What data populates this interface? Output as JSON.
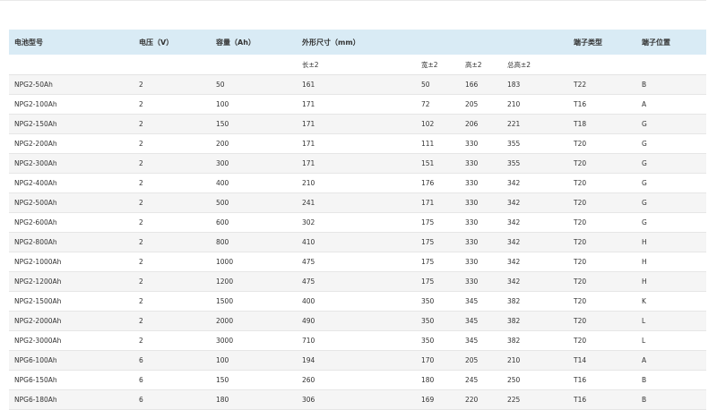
{
  "headers": {
    "model": "电池型号",
    "voltage": "电压（V）",
    "capacity": "容量（Ah）",
    "dimensions": "外形尺寸（mm）",
    "terminal_type": "端子类型",
    "terminal_position": "端子位置"
  },
  "subheaders": {
    "length": "长±2",
    "width": "宽±2",
    "height": "高±2",
    "total_height": "总高±2"
  },
  "rows": [
    [
      "NPG2-50Ah",
      "2",
      "50",
      "161",
      "50",
      "166",
      "183",
      "T22",
      "B"
    ],
    [
      "NPG2-100Ah",
      "2",
      "100",
      "171",
      "72",
      "205",
      "210",
      "T16",
      "A"
    ],
    [
      "NPG2-150Ah",
      "2",
      "150",
      "171",
      "102",
      "206",
      "221",
      "T18",
      "G"
    ],
    [
      "NPG2-200Ah",
      "2",
      "200",
      "171",
      "111",
      "330",
      "355",
      "T20",
      "G"
    ],
    [
      "NPG2-300Ah",
      "2",
      "300",
      "171",
      "151",
      "330",
      "355",
      "T20",
      "G"
    ],
    [
      "NPG2-400Ah",
      "2",
      "400",
      "210",
      "176",
      "330",
      "342",
      "T20",
      "G"
    ],
    [
      "NPG2-500Ah",
      "2",
      "500",
      "241",
      "171",
      "330",
      "342",
      "T20",
      "G"
    ],
    [
      "NPG2-600Ah",
      "2",
      "600",
      "302",
      "175",
      "330",
      "342",
      "T20",
      "G"
    ],
    [
      "NPG2-800Ah",
      "2",
      "800",
      "410",
      "175",
      "330",
      "342",
      "T20",
      "H"
    ],
    [
      "NPG2-1000Ah",
      "2",
      "1000",
      "475",
      "175",
      "330",
      "342",
      "T20",
      "H"
    ],
    [
      "NPG2-1200Ah",
      "2",
      "1200",
      "475",
      "175",
      "330",
      "342",
      "T20",
      "H"
    ],
    [
      "NPG2-1500Ah",
      "2",
      "1500",
      "400",
      "350",
      "345",
      "382",
      "T20",
      "K"
    ],
    [
      "NPG2-2000Ah",
      "2",
      "2000",
      "490",
      "350",
      "345",
      "382",
      "T20",
      "L"
    ],
    [
      "NPG2-3000Ah",
      "2",
      "3000",
      "710",
      "350",
      "345",
      "382",
      "T20",
      "L"
    ],
    [
      "NPG6-100Ah",
      "6",
      "100",
      "194",
      "170",
      "205",
      "210",
      "T14",
      "A"
    ],
    [
      "NPG6-150Ah",
      "6",
      "150",
      "260",
      "180",
      "245",
      "250",
      "T16",
      "B"
    ],
    [
      "NPG6-180Ah",
      "6",
      "180",
      "306",
      "169",
      "220",
      "225",
      "T16",
      "B"
    ]
  ]
}
